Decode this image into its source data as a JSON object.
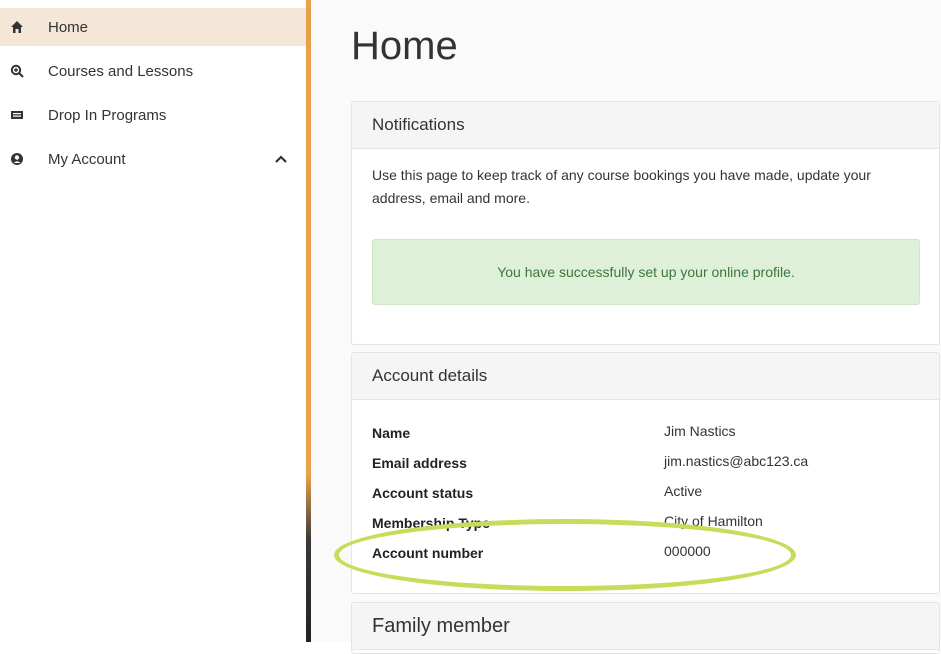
{
  "sidebar": {
    "items": [
      {
        "label": "Home",
        "icon": "home-icon",
        "active": true
      },
      {
        "label": "Courses and Lessons",
        "icon": "search-icon"
      },
      {
        "label": "Drop In Programs",
        "icon": "ticket-icon"
      },
      {
        "label": "My Account",
        "icon": "user-circle-icon",
        "expand_icon": "chevron-up-icon"
      }
    ]
  },
  "main": {
    "title": "Home",
    "notifications": {
      "header": "Notifications",
      "text": "Use this page to keep track of any course bookings you have made, update your address, email and more.",
      "success_message": "You have successfully set up your online profile."
    },
    "account_details": {
      "header": "Account details",
      "rows": [
        {
          "label": "Name",
          "value": "Jim Nastics"
        },
        {
          "label": "Email address",
          "value": "jim.nastics@abc123.ca"
        },
        {
          "label": "Account status",
          "value": "Active"
        },
        {
          "label": "Membership Type",
          "value": "City of Hamilton"
        },
        {
          "label": "Account number",
          "value": "000000"
        }
      ]
    },
    "family": {
      "header": "Family member"
    }
  },
  "colors": {
    "accent": "#e8a14a",
    "active_bg": "#f5e7d8",
    "success_bg": "#dff0d8",
    "success_text": "#3c763d",
    "highlight": "#c6dc5a"
  }
}
